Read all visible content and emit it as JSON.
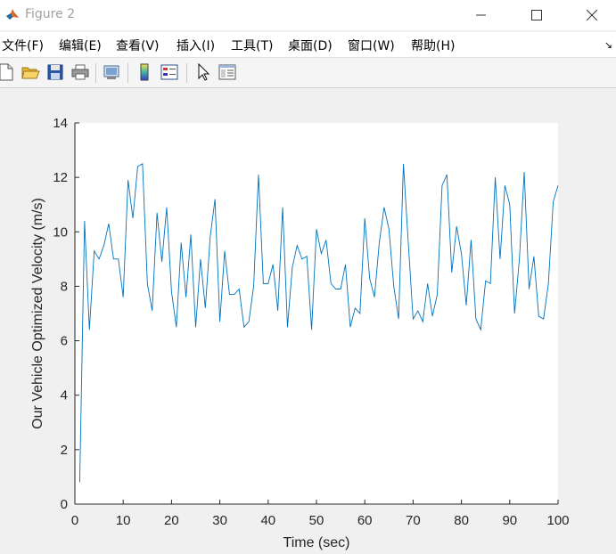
{
  "window": {
    "title": "Figure 2"
  },
  "menu": {
    "items": [
      "文件(F)",
      "编辑(E)",
      "查看(V)",
      "插入(I)",
      "工具(T)",
      "桌面(D)",
      "窗口(W)",
      "帮助(H)"
    ],
    "overflow_glyph": "↘"
  },
  "toolbar": {
    "icons": [
      "new-figure-icon",
      "open-file-icon",
      "save-icon",
      "print-icon",
      "print-preview-icon",
      "colorbar-icon",
      "legend-icon",
      "pointer-icon",
      "property-editor-icon"
    ]
  },
  "colors": {
    "line": "#0072BD",
    "axes_bg": "#ffffff",
    "figure_bg": "#f0f0f0"
  },
  "chart_data": {
    "type": "line",
    "xlabel": "Time (sec)",
    "ylabel": "Our Vehicle Optimized Velocity (m/s)",
    "xlim": [
      0,
      100
    ],
    "ylim": [
      0,
      14
    ],
    "xticks": [
      0,
      10,
      20,
      30,
      40,
      50,
      60,
      70,
      80,
      90,
      100
    ],
    "yticks": [
      0,
      2,
      4,
      6,
      8,
      10,
      12,
      14
    ],
    "grid": false,
    "series": [
      {
        "x": [
          1,
          2,
          3,
          4,
          5,
          6,
          7,
          8,
          9,
          10,
          11,
          12,
          13,
          14,
          15,
          16,
          17,
          18,
          19,
          20,
          21,
          22,
          23,
          24,
          25,
          26,
          27,
          28,
          29,
          30,
          31,
          32,
          33,
          34,
          35,
          36,
          37,
          38,
          39,
          40,
          41,
          42,
          43,
          44,
          45,
          46,
          47,
          48,
          49,
          50,
          51,
          52,
          53,
          54,
          55,
          56,
          57,
          58,
          59,
          60,
          61,
          62,
          63,
          64,
          65,
          66,
          67,
          68,
          69,
          70,
          71,
          72,
          73,
          74,
          75,
          76,
          77,
          78,
          79,
          80,
          81,
          82,
          83,
          84,
          85,
          86,
          87,
          88,
          89,
          90,
          91,
          92,
          93,
          94,
          95,
          96,
          97,
          98,
          99,
          100
        ],
        "y": [
          0.8,
          10.4,
          6.4,
          9.3,
          9.0,
          9.5,
          10.3,
          9.0,
          9.0,
          7.6,
          11.9,
          10.5,
          12.4,
          12.5,
          8.1,
          7.1,
          10.7,
          8.9,
          10.9,
          7.8,
          6.5,
          9.6,
          7.6,
          9.9,
          6.5,
          9.0,
          7.2,
          9.8,
          11.2,
          6.7,
          9.3,
          7.7,
          7.7,
          7.9,
          6.5,
          6.7,
          8.0,
          12.1,
          8.1,
          8.1,
          8.8,
          7.1,
          10.9,
          6.5,
          8.7,
          9.5,
          9.0,
          9.1,
          6.4,
          10.1,
          9.2,
          9.7,
          8.1,
          7.9,
          7.9,
          8.8,
          6.5,
          7.2,
          7.0,
          10.5,
          8.3,
          7.6,
          9.6,
          10.9,
          10.1,
          8.0,
          6.8,
          12.5,
          9.6,
          6.8,
          7.1,
          6.7,
          8.1,
          6.9,
          7.7,
          11.7,
          12.1,
          8.5,
          10.2,
          9.2,
          7.3,
          9.7,
          6.8,
          6.4,
          8.2,
          8.1,
          12.0,
          9.0,
          11.7,
          11.0,
          7.0,
          9.0,
          12.2,
          7.9,
          9.1,
          6.9,
          6.8,
          8.1,
          11.1,
          11.7
        ]
      }
    ]
  }
}
